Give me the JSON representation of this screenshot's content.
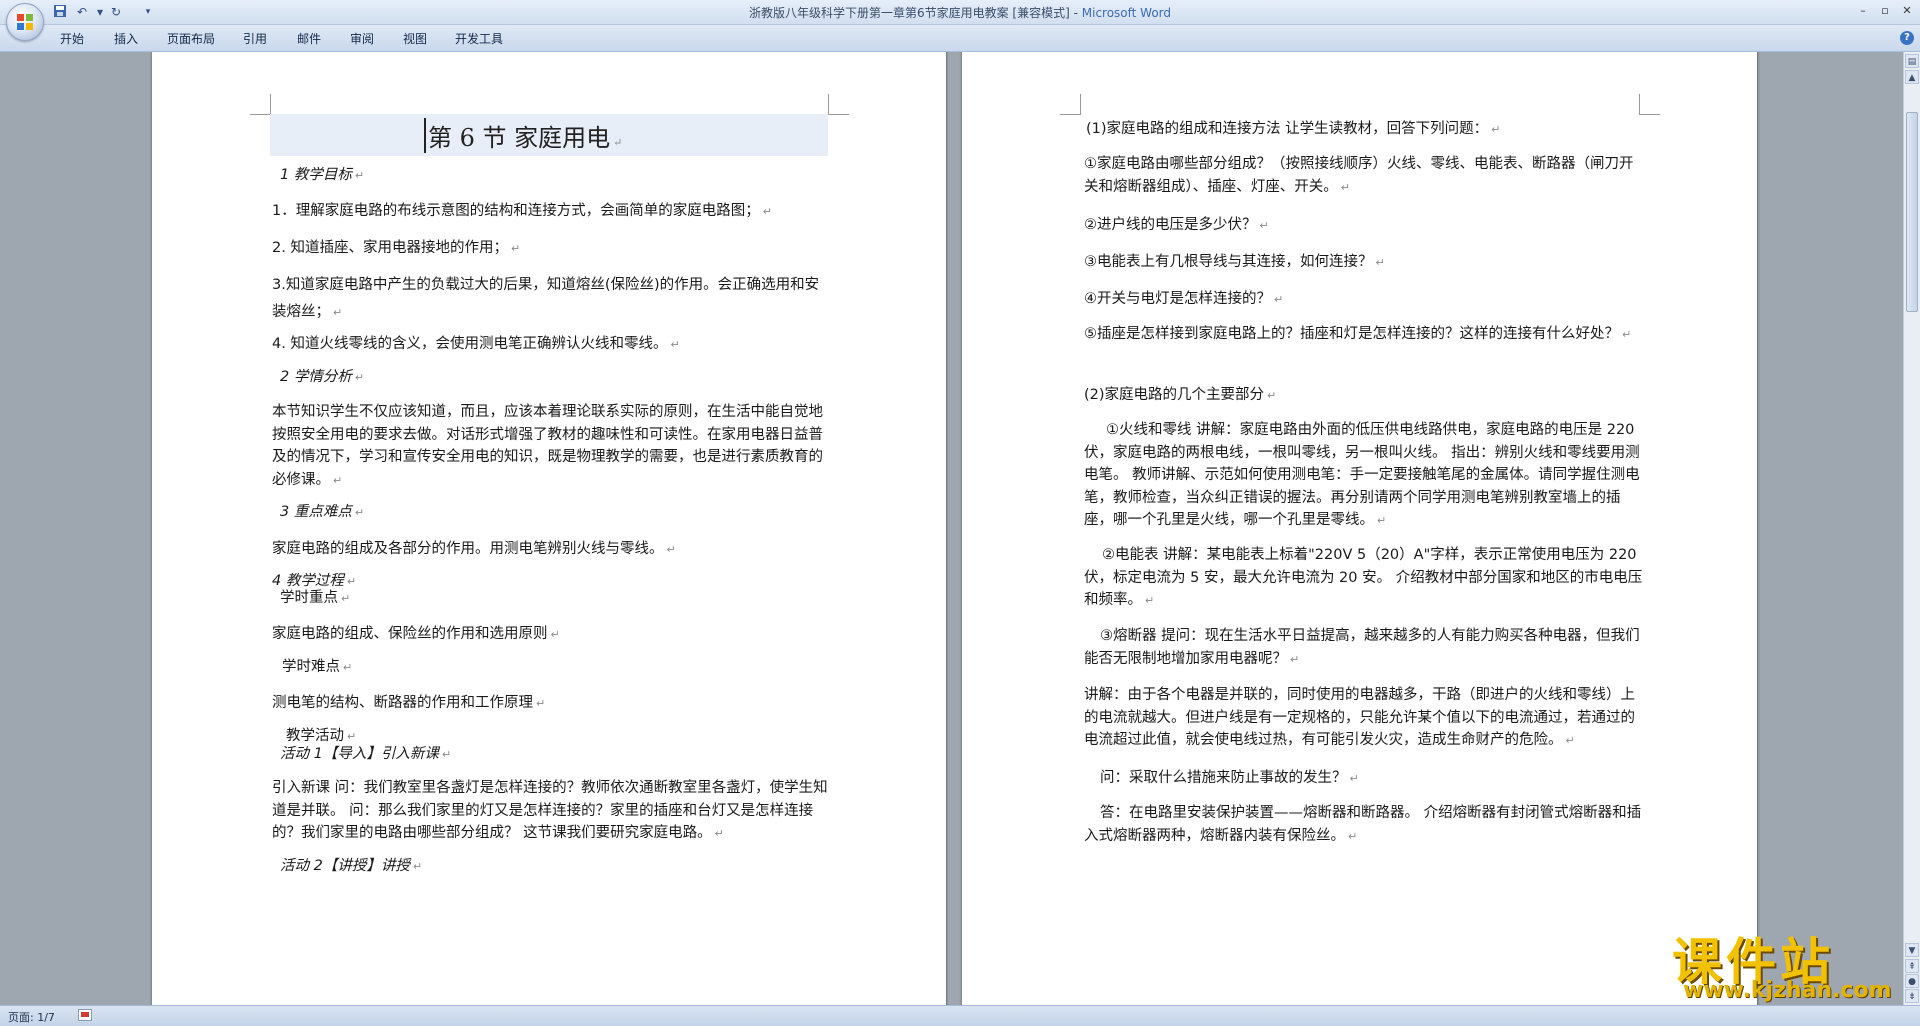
{
  "window": {
    "title": "浙教版八年级科学下册第一章第6节家庭用电教案 [兼容模式] - ",
    "app_name": "Microsoft Word"
  },
  "ribbon": {
    "tabs": [
      "开始",
      "插入",
      "页面布局",
      "引用",
      "邮件",
      "审阅",
      "视图",
      "开发工具"
    ]
  },
  "left_page": {
    "title": "第 6 节   家庭用电",
    "paragraphs": [
      "1 教学目标",
      "1．理解家庭电路的布线示意图的结构和连接方式，会画简单的家庭电路图；",
      "2. 知道插座、家用电器接地的作用；",
      "3.知道家庭电路中产生的负载过大的后果，知道熔丝(保险丝)的作用。会正确选用和安装熔丝；",
      "4. 知道火线零线的含义，会使用测电笔正确辨认火线和零线。",
      "2 学情分析",
      "本节知识学生不仅应该知道，而且，应该本着理论联系实际的原则，在生活中能自觉地按照安全用电的要求去做。对话形式增强了教材的趣味性和可读性。在家用电器日益普及的情况下，学习和宣传安全用电的知识，既是物理教学的需要，也是进行素质教育的必修课。",
      "3 重点难点",
      "家庭电路的组成及各部分的作用。用测电笔辨别火线与零线。",
      "4 教学过程",
      "学时重点",
      "家庭电路的组成、保险丝的作用和选用原则",
      "学时难点",
      "测电笔的结构、断路器的作用和工作原理",
      "教学活动",
      "活动 1【导入】引入新课",
      "引入新课  问：我们教室里各盏灯是怎样连接的？教师依次通断教室里各盏灯，使学生知道是并联。 问：那么我们家里的灯又是怎样连接的？家里的插座和台灯又是怎样连接的？我们家里的电路由哪些部分组成？   这节课我们要研究家庭电路。",
      "活动 2【讲授】讲授"
    ]
  },
  "right_page": {
    "paragraphs": [
      "(1)家庭电路的组成和连接方法   让学生读教材，回答下列问题：",
      "①家庭电路由哪些部分组成？（按照接线顺序）火线、零线、电能表、断路器（闸刀开关和熔断器组成）、插座、灯座、开关。",
      "②进户线的电压是多少伏？",
      "③电能表上有几根导线与其连接，如何连接？",
      "④开关与电灯是怎样连接的？",
      "⑤插座是怎样接到家庭电路上的？插座和灯是怎样连接的？这样的连接有什么好处？",
      "(2)家庭电路的几个主要部分",
      "①火线和零线  讲解：家庭电路由外面的低压供电线路供电，家庭电路的电压是 220 伏，家庭电路的两根电线，一根叫零线，另一根叫火线。 指出：辨别火线和零线要用测电笔。 教师讲解、示范如何使用测电笔：手一定要接触笔尾的金属体。请同学握住测电笔，教师检查，当众纠正错误的握法。再分别请两个同学用测电笔辨别教室墙上的插座，哪一个孔里是火线，哪一个孔里是零线。",
      "②电能表  讲解：某电能表上标着\"220V   5（20）A\"字样，表示正常使用电压为 220 伏，标定电流为 5 安，最大允许电流为 20 安。   介绍教材中部分国家和地区的市电电压和频率。",
      "③熔断器  提问：现在生活水平日益提高，越来越多的人有能力购买各种电器，但我们能否无限制地增加家用电器呢？",
      "讲解：由于各个电器是并联的，同时使用的电器越多，干路（即进户的火线和零线）上的电流就越大。但进户线是有一定规格的，只能允许某个值以下的电流通过，若通过的电流超过此值，就会使电线过热，有可能引发火灾，造成生命财产的危险。",
      "问：采取什么措施来防止事故的发生？",
      "答：在电路里安装保护装置——熔断器和断路器。   介绍熔断器有封闭管式熔断器和插入式熔断器两种，熔断器内装有保险丝。"
    ]
  },
  "status": {
    "page": "页面: 1/7"
  },
  "watermark": {
    "brand": "课件站",
    "url": "www.kjzhan.com"
  },
  "colors": {
    "ribbon_bg": "#dfe9f6",
    "workspace": "#9ea6b0",
    "watermark": "#f2c200"
  },
  "icons": [
    "office-button",
    "save-icon",
    "undo-icon",
    "redo-icon",
    "customize-icon",
    "minimize-icon",
    "maximize-icon",
    "close-icon",
    "help-icon"
  ]
}
